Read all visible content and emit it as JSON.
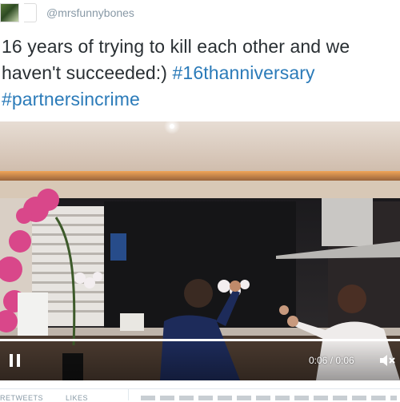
{
  "author": {
    "handle": "@mrsfunnybones"
  },
  "tweet": {
    "text": "16 years of trying to kill each other and we haven't succeeded:) ",
    "hashtags": [
      "#16thanniversary",
      "#partnersincrime"
    ]
  },
  "video": {
    "current_time": "0:06",
    "separator": " / ",
    "duration": "0:06",
    "progress_fraction": 1.0,
    "play_state": "pause-icon",
    "volume_icon": "muted-speaker-icon"
  },
  "stats": {
    "retweets_label": "RETWEETS",
    "likes_label": "LIKES"
  },
  "colors": {
    "text": "#292f33",
    "link": "#2b7bb9",
    "handle": "#8899a6"
  }
}
